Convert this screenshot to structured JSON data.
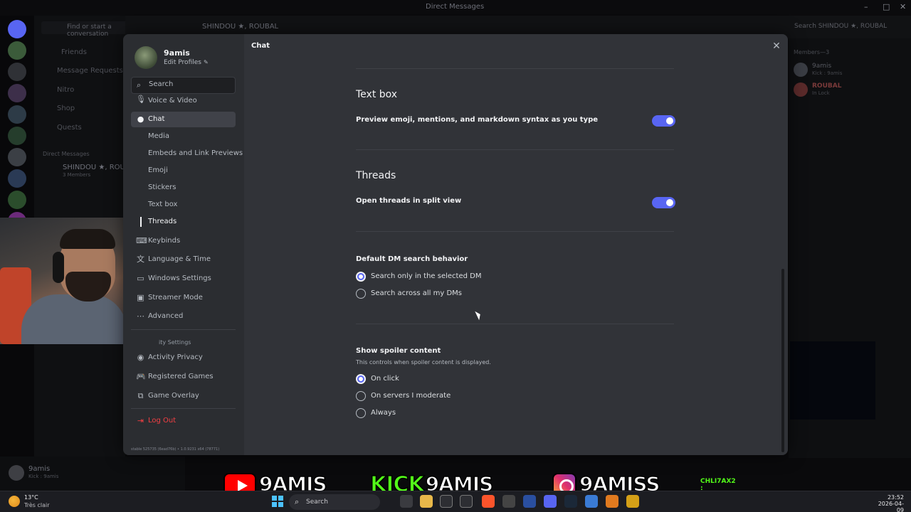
{
  "window": {
    "title": "Direct Messages",
    "find_placeholder": "Find or start a conversation",
    "channel": "SHINDOU ★, ROUBAL",
    "channel_search": "Search SHINDOU ★, ROUBAL"
  },
  "background": {
    "dm_nav": [
      "Friends",
      "Message Requests",
      "Nitro",
      "Shop",
      "Quests"
    ],
    "dm_header": "Direct Messages",
    "dm_group_name": "SHINDOU ★, ROU",
    "dm_group_members": "3 Members",
    "members_header": "Members—3",
    "members": [
      {
        "name": "9amis",
        "status": "Kick : 9amis"
      },
      {
        "name": "ROUBAL",
        "status": "In Lock"
      }
    ],
    "user_name": "9amis",
    "user_status": "Kick : 9amis"
  },
  "modal": {
    "profile": {
      "name": "9amis",
      "edit_label": "Edit Profiles"
    },
    "search_placeholder": "Search",
    "nav": {
      "voice_video": "Voice & Video",
      "chat": "Chat",
      "sub": [
        "Media",
        "Embeds and Link Previews",
        "Emoji",
        "Stickers",
        "Text box",
        "Threads"
      ],
      "keybinds": "Keybinds",
      "language_time": "Language & Time",
      "windows_settings": "Windows Settings",
      "streamer_mode": "Streamer Mode",
      "advanced": "Advanced",
      "activity_header": "ity Settings",
      "activity_privacy": "Activity Privacy",
      "registered_games": "Registered Games",
      "game_overlay": "Game Overlay",
      "log_out": "Log Out",
      "version": "stable 525735 (6ead76b) • 1.0.9231 x64 (78771)"
    },
    "content": {
      "title": "Chat",
      "text_box": {
        "heading": "Text box",
        "option": "Preview emoji, mentions, and markdown syntax as you type",
        "enabled": true
      },
      "threads": {
        "heading": "Threads",
        "option": "Open threads in split view",
        "enabled": true
      },
      "dm_search": {
        "label": "Default DM search behavior",
        "options": [
          "Search only in the selected DM",
          "Search across all my DMs"
        ],
        "selected": 0
      },
      "spoiler": {
        "label": "Show spoiler content",
        "description": "This controls when spoiler content is displayed.",
        "options": [
          "On click",
          "On servers I moderate",
          "Always"
        ],
        "selected": 0
      }
    }
  },
  "banner": {
    "youtube": "9AMIS",
    "kick_word": "KICK",
    "kick": "9AMIS",
    "instagram": "9AMISS",
    "chat_text": "CHLI7AX2 :"
  },
  "taskbar": {
    "temperature": "13°C",
    "weather": "Très clair",
    "search": "Search",
    "time": "23:52",
    "date": "2026-04-09"
  },
  "colors": {
    "accent": "#5865f2",
    "danger": "#f23f43"
  }
}
